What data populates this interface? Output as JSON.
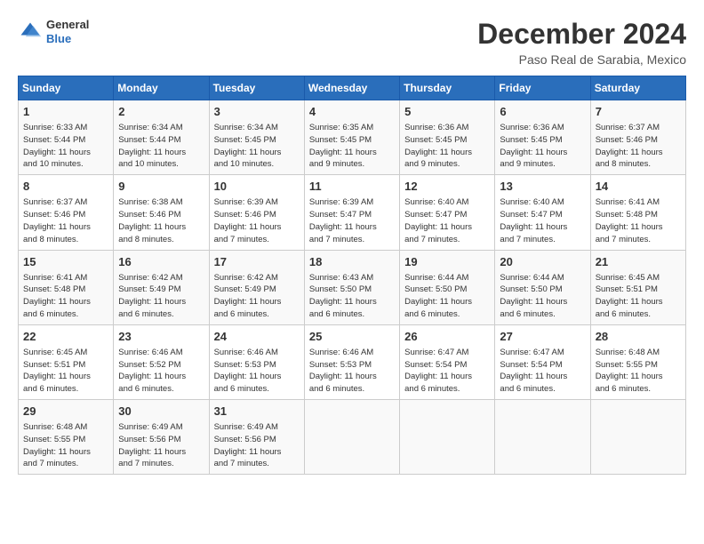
{
  "header": {
    "logo_line1": "General",
    "logo_line2": "Blue",
    "month": "December 2024",
    "location": "Paso Real de Sarabia, Mexico"
  },
  "days_of_week": [
    "Sunday",
    "Monday",
    "Tuesday",
    "Wednesday",
    "Thursday",
    "Friday",
    "Saturday"
  ],
  "weeks": [
    [
      {
        "day": "1",
        "info": "Sunrise: 6:33 AM\nSunset: 5:44 PM\nDaylight: 11 hours\nand 10 minutes."
      },
      {
        "day": "2",
        "info": "Sunrise: 6:34 AM\nSunset: 5:44 PM\nDaylight: 11 hours\nand 10 minutes."
      },
      {
        "day": "3",
        "info": "Sunrise: 6:34 AM\nSunset: 5:45 PM\nDaylight: 11 hours\nand 10 minutes."
      },
      {
        "day": "4",
        "info": "Sunrise: 6:35 AM\nSunset: 5:45 PM\nDaylight: 11 hours\nand 9 minutes."
      },
      {
        "day": "5",
        "info": "Sunrise: 6:36 AM\nSunset: 5:45 PM\nDaylight: 11 hours\nand 9 minutes."
      },
      {
        "day": "6",
        "info": "Sunrise: 6:36 AM\nSunset: 5:45 PM\nDaylight: 11 hours\nand 9 minutes."
      },
      {
        "day": "7",
        "info": "Sunrise: 6:37 AM\nSunset: 5:46 PM\nDaylight: 11 hours\nand 8 minutes."
      }
    ],
    [
      {
        "day": "8",
        "info": "Sunrise: 6:37 AM\nSunset: 5:46 PM\nDaylight: 11 hours\nand 8 minutes."
      },
      {
        "day": "9",
        "info": "Sunrise: 6:38 AM\nSunset: 5:46 PM\nDaylight: 11 hours\nand 8 minutes."
      },
      {
        "day": "10",
        "info": "Sunrise: 6:39 AM\nSunset: 5:46 PM\nDaylight: 11 hours\nand 7 minutes."
      },
      {
        "day": "11",
        "info": "Sunrise: 6:39 AM\nSunset: 5:47 PM\nDaylight: 11 hours\nand 7 minutes."
      },
      {
        "day": "12",
        "info": "Sunrise: 6:40 AM\nSunset: 5:47 PM\nDaylight: 11 hours\nand 7 minutes."
      },
      {
        "day": "13",
        "info": "Sunrise: 6:40 AM\nSunset: 5:47 PM\nDaylight: 11 hours\nand 7 minutes."
      },
      {
        "day": "14",
        "info": "Sunrise: 6:41 AM\nSunset: 5:48 PM\nDaylight: 11 hours\nand 7 minutes."
      }
    ],
    [
      {
        "day": "15",
        "info": "Sunrise: 6:41 AM\nSunset: 5:48 PM\nDaylight: 11 hours\nand 6 minutes."
      },
      {
        "day": "16",
        "info": "Sunrise: 6:42 AM\nSunset: 5:49 PM\nDaylight: 11 hours\nand 6 minutes."
      },
      {
        "day": "17",
        "info": "Sunrise: 6:42 AM\nSunset: 5:49 PM\nDaylight: 11 hours\nand 6 minutes."
      },
      {
        "day": "18",
        "info": "Sunrise: 6:43 AM\nSunset: 5:50 PM\nDaylight: 11 hours\nand 6 minutes."
      },
      {
        "day": "19",
        "info": "Sunrise: 6:44 AM\nSunset: 5:50 PM\nDaylight: 11 hours\nand 6 minutes."
      },
      {
        "day": "20",
        "info": "Sunrise: 6:44 AM\nSunset: 5:50 PM\nDaylight: 11 hours\nand 6 minutes."
      },
      {
        "day": "21",
        "info": "Sunrise: 6:45 AM\nSunset: 5:51 PM\nDaylight: 11 hours\nand 6 minutes."
      }
    ],
    [
      {
        "day": "22",
        "info": "Sunrise: 6:45 AM\nSunset: 5:51 PM\nDaylight: 11 hours\nand 6 minutes."
      },
      {
        "day": "23",
        "info": "Sunrise: 6:46 AM\nSunset: 5:52 PM\nDaylight: 11 hours\nand 6 minutes."
      },
      {
        "day": "24",
        "info": "Sunrise: 6:46 AM\nSunset: 5:53 PM\nDaylight: 11 hours\nand 6 minutes."
      },
      {
        "day": "25",
        "info": "Sunrise: 6:46 AM\nSunset: 5:53 PM\nDaylight: 11 hours\nand 6 minutes."
      },
      {
        "day": "26",
        "info": "Sunrise: 6:47 AM\nSunset: 5:54 PM\nDaylight: 11 hours\nand 6 minutes."
      },
      {
        "day": "27",
        "info": "Sunrise: 6:47 AM\nSunset: 5:54 PM\nDaylight: 11 hours\nand 6 minutes."
      },
      {
        "day": "28",
        "info": "Sunrise: 6:48 AM\nSunset: 5:55 PM\nDaylight: 11 hours\nand 6 minutes."
      }
    ],
    [
      {
        "day": "29",
        "info": "Sunrise: 6:48 AM\nSunset: 5:55 PM\nDaylight: 11 hours\nand 7 minutes."
      },
      {
        "day": "30",
        "info": "Sunrise: 6:49 AM\nSunset: 5:56 PM\nDaylight: 11 hours\nand 7 minutes."
      },
      {
        "day": "31",
        "info": "Sunrise: 6:49 AM\nSunset: 5:56 PM\nDaylight: 11 hours\nand 7 minutes."
      },
      {
        "day": "",
        "info": ""
      },
      {
        "day": "",
        "info": ""
      },
      {
        "day": "",
        "info": ""
      },
      {
        "day": "",
        "info": ""
      }
    ]
  ]
}
